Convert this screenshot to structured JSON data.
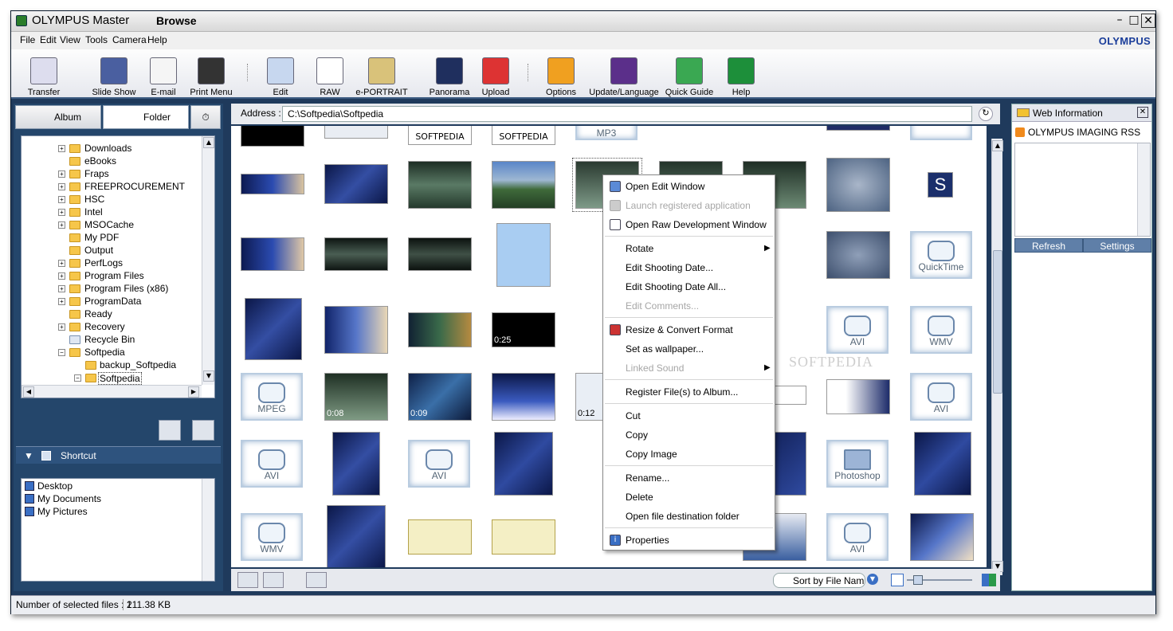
{
  "window": {
    "app_title": "OLYMPUS Master",
    "mode_title": "Browse",
    "min": "–",
    "max": "□",
    "close": "✕"
  },
  "menu": [
    "File",
    "Edit",
    "View",
    "Tools",
    "Camera",
    "Help"
  ],
  "brand": "OLYMPUS",
  "toolbar": [
    "Transfer",
    "Slide Show",
    "E-mail",
    "Print Menu",
    "Edit",
    "RAW",
    "e-PORTRAIT",
    "Panorama",
    "Upload",
    "Options",
    "Update/Language",
    "Quick Guide",
    "Help"
  ],
  "tabs": {
    "album": "Album",
    "folder": "Folder"
  },
  "tree": {
    "items": [
      "Downloads",
      "eBooks",
      "Fraps",
      "FREEPROCUREMENT",
      "HSC",
      "Intel",
      "MSOCache",
      "My PDF",
      "Output",
      "PerfLogs",
      "Program Files",
      "Program Files (x86)",
      "ProgramData",
      "Ready",
      "Recovery",
      "Recycle Bin",
      "Softpedia",
      "backup_Softpedia",
      "Softpedia"
    ]
  },
  "shortcut": {
    "title": "Shortcut",
    "items": [
      "Desktop",
      "My Documents",
      "My Pictures"
    ]
  },
  "address": {
    "label": "Address :",
    "value": "C:\\Softpedia\\Softpedia"
  },
  "thumb_labels": [
    "SOFTPEDIA",
    "SOFTPEDIA",
    "MP3",
    "QuickTime",
    "AVI",
    "WMV",
    "MPEG",
    "AVI",
    "AVI",
    "WMV",
    "Photoshop",
    "WMV",
    "AVI",
    "0:25",
    "0:08",
    "0:09",
    "0:12"
  ],
  "context_menu": {
    "items": [
      "Open Edit Window",
      "Launch registered application",
      "Open Raw Development Window",
      "Rotate",
      "Edit Shooting Date...",
      "Edit Shooting Date All...",
      "Edit Comments...",
      "Resize & Convert Format",
      "Set as wallpaper...",
      "Linked Sound",
      "Register File(s) to Album...",
      "Cut",
      "Copy",
      "Copy Image",
      "Rename...",
      "Delete",
      "Open file destination folder",
      "Properties"
    ]
  },
  "sort": "Sort by File Nam",
  "web_panel": {
    "title": "Web Information",
    "rss": "OLYMPUS IMAGING RSS",
    "refresh": "Refresh",
    "settings": "Settings"
  },
  "status": {
    "selected": "Number of selected files : 1",
    "size": "211.38 KB"
  },
  "watermark": "SOFTPEDIA",
  "colors": {
    "frame": "#1f3a5c",
    "panel": "#24466b",
    "brand": "#1a3d9a"
  }
}
